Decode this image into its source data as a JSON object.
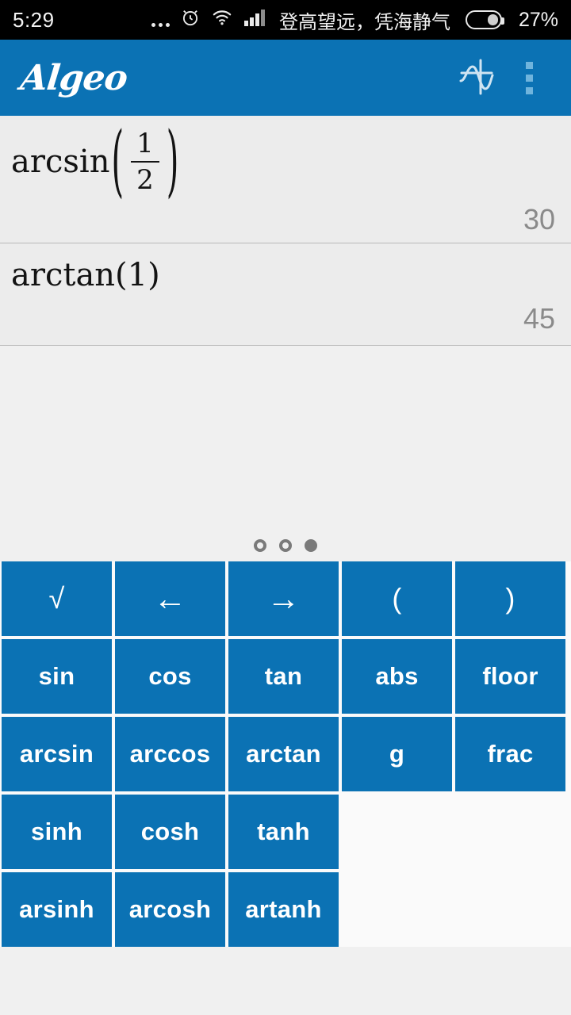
{
  "statusbar": {
    "clock": "5:29",
    "overflow_dots_icon": "more-dots-icon",
    "alarm_icon": "alarm-clock-icon",
    "wifi_icon": "wifi-icon",
    "signal_icon": "cellular-signal-icon",
    "carrier": "登高望远，凭海静气",
    "battery_icon": "battery-icon",
    "battery_percent": "27%"
  },
  "appbar": {
    "title": "Algeo",
    "graph_icon": "function-graph-icon",
    "overflow_icon": "overflow-menu-icon",
    "accent_color": "#0b72b4"
  },
  "history": [
    {
      "expression_text": "arcsin(1/2)",
      "func_name": "arcsin",
      "open_paren": "(",
      "numerator": "1",
      "denominator": "2",
      "close_paren": ")",
      "result": "30"
    },
    {
      "expression_text": "arctan(1)",
      "func_name": "arctan(1)",
      "result": "45"
    }
  ],
  "pager": {
    "total": 3,
    "current": 3,
    "dots": [
      "page-dot-1",
      "page-dot-2",
      "page-dot-3"
    ]
  },
  "keypad": {
    "rows": [
      [
        {
          "label": "√",
          "name": "key-sqrt",
          "style": "sym"
        },
        {
          "label": "←",
          "name": "key-cursor-left",
          "style": "arrow"
        },
        {
          "label": "→",
          "name": "key-cursor-right",
          "style": "arrow"
        },
        {
          "label": "(",
          "name": "key-open-paren",
          "style": "sym"
        },
        {
          "label": ")",
          "name": "key-close-paren",
          "style": "sym"
        }
      ],
      [
        {
          "label": "sin",
          "name": "key-sin",
          "style": "txt"
        },
        {
          "label": "cos",
          "name": "key-cos",
          "style": "txt"
        },
        {
          "label": "tan",
          "name": "key-tan",
          "style": "txt"
        },
        {
          "label": "abs",
          "name": "key-abs",
          "style": "txt"
        },
        {
          "label": "floor",
          "name": "key-floor",
          "style": "txt"
        }
      ],
      [
        {
          "label": "arcsin",
          "name": "key-arcsin",
          "style": "txt"
        },
        {
          "label": "arccos",
          "name": "key-arccos",
          "style": "txt"
        },
        {
          "label": "arctan",
          "name": "key-arctan",
          "style": "txt"
        },
        {
          "label": "g",
          "name": "key-g",
          "style": "txt"
        },
        {
          "label": "frac",
          "name": "key-frac",
          "style": "txt"
        }
      ],
      [
        {
          "label": "sinh",
          "name": "key-sinh",
          "style": "txt"
        },
        {
          "label": "cosh",
          "name": "key-cosh",
          "style": "txt"
        },
        {
          "label": "tanh",
          "name": "key-tanh",
          "style": "txt"
        }
      ],
      [
        {
          "label": "arsinh",
          "name": "key-arsinh",
          "style": "txt"
        },
        {
          "label": "arcosh",
          "name": "key-arcosh",
          "style": "txt"
        },
        {
          "label": "artanh",
          "name": "key-artanh",
          "style": "txt"
        }
      ]
    ]
  }
}
